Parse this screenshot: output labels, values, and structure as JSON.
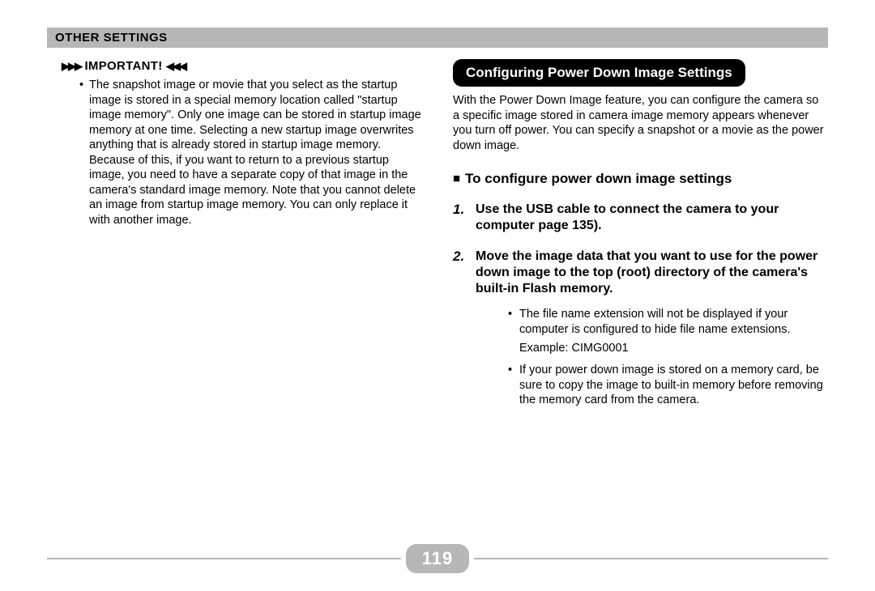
{
  "header": "OTHER SETTINGS",
  "left": {
    "important_label": "IMPORTANT!",
    "arrows_left": "▶▶▶",
    "arrows_right": "◀◀◀",
    "bullet": "The snapshot image or movie that you select as the startup image is stored in a special memory location called \"startup image memory\". Only one image can be stored in startup image memory at one time. Selecting a new startup image overwrites anything that is already stored in startup image memory. Because of this, if you want to return to a previous startup image, you need to have a separate copy of that image in the camera's standard image memory. Note that you cannot delete an image from startup image memory. You can only replace it with another image."
  },
  "right": {
    "title": "Configuring Power Down Image Settings",
    "intro": "With the Power Down Image feature, you can configure the camera so a specific image stored in camera image memory appears whenever you turn off power. You can specify a snapshot or a movie as the power down image.",
    "subhead": "To configure power down image settings",
    "steps": [
      {
        "num": "1.",
        "text": "Use the USB cable to connect the camera to your computer page 135)."
      },
      {
        "num": "2.",
        "text": "Move the image data that you want to use for the power down image to the top (root) directory of the camera's built-in Flash memory.",
        "subs": [
          "The file name extension will not be displayed if your computer is configured to hide file name extensions."
        ],
        "extra": "Example: CIMG0001",
        "subs2": [
          "If your power down image is stored on a memory card, be sure to copy the image to built-in memory before removing the memory card from the camera."
        ]
      }
    ]
  },
  "page_number": "119"
}
